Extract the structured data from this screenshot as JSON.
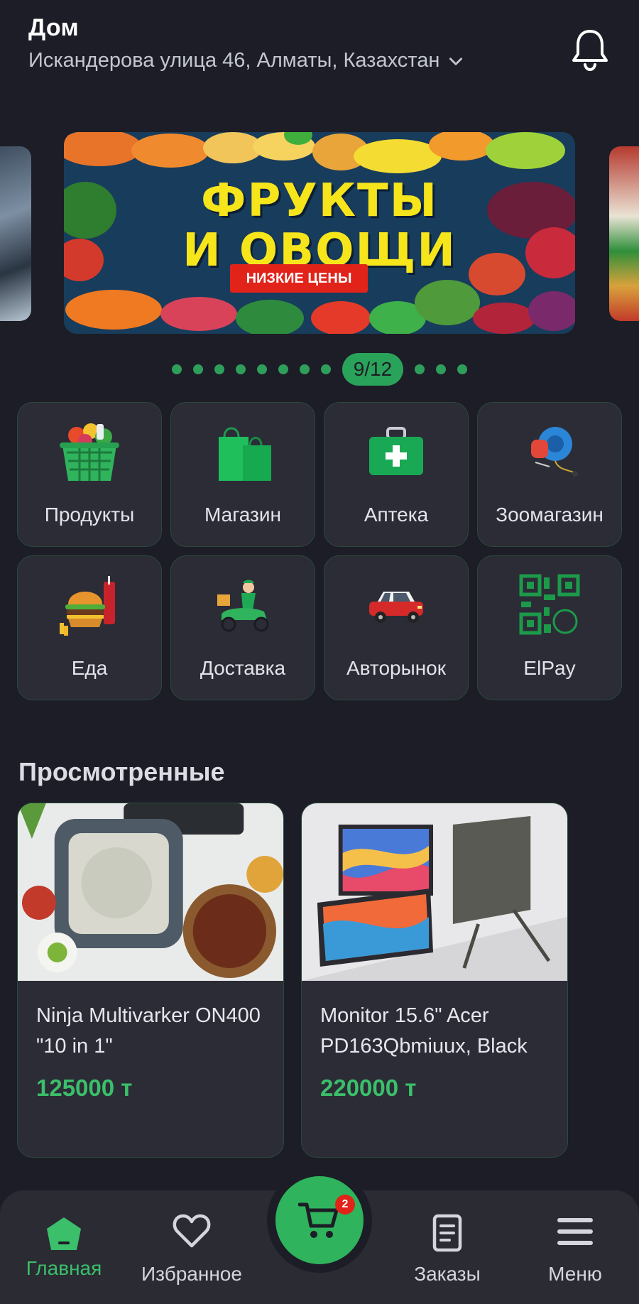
{
  "header": {
    "title": "Дом",
    "address": "Искандерова улица 46, Алматы, Казахстан"
  },
  "banner": {
    "title_line1": "ФРУКТЫ",
    "title_line2": "И ОВОЩИ",
    "badge": "НИЗКИЕ ЦЕНЫ",
    "counter": "9/12",
    "dots_before": 8,
    "dots_after": 3
  },
  "categories": [
    {
      "label": "Продукты",
      "icon": "grocery-basket-icon"
    },
    {
      "label": "Магазин",
      "icon": "shopping-bags-icon"
    },
    {
      "label": "Аптека",
      "icon": "first-aid-kit-icon"
    },
    {
      "label": "Зоомагазин",
      "icon": "pet-leash-icon"
    },
    {
      "label": "Еда",
      "icon": "burger-icon"
    },
    {
      "label": "Доставка",
      "icon": "courier-scooter-icon"
    },
    {
      "label": "Авторынок",
      "icon": "car-icon"
    },
    {
      "label": "ElPay",
      "icon": "qr-code-icon"
    }
  ],
  "viewed": {
    "title": "Просмотренные",
    "products": [
      {
        "name": "Ninja Multivarker ON400 \"10 in 1\"",
        "price": "125000 т"
      },
      {
        "name": "Monitor 15.6\" Acer PD163Qbmiuux, Black",
        "price": "220000 т"
      }
    ]
  },
  "nav": {
    "home": "Главная",
    "favorites": "Избранное",
    "orders": "Заказы",
    "menu": "Меню",
    "cart_count": "2"
  },
  "colors": {
    "background": "#1c1d26",
    "accent": "#3bbf6a",
    "card": "#2b2c36",
    "banner_title": "#f7e51c",
    "badge_red": "#e2231a"
  }
}
